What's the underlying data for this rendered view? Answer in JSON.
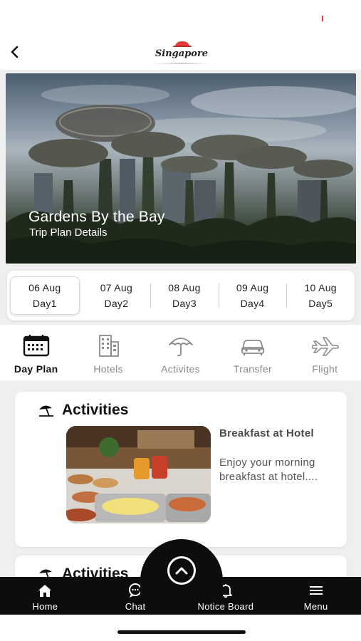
{
  "header": {
    "back_label": "‹",
    "logo_text": "Singapore"
  },
  "hero": {
    "title": "Gardens By the Bay",
    "subtitle": "Trip Plan Details"
  },
  "days": [
    {
      "date": "06 Aug",
      "label": "Day1",
      "active": true
    },
    {
      "date": "07 Aug",
      "label": "Day2",
      "active": false
    },
    {
      "date": "08 Aug",
      "label": "Day3",
      "active": false
    },
    {
      "date": "09 Aug",
      "label": "Day4",
      "active": false
    },
    {
      "date": "10 Aug",
      "label": "Day5",
      "active": false
    }
  ],
  "tabs": [
    {
      "label": "Day Plan",
      "icon": "calendar-icon",
      "active": true
    },
    {
      "label": "Hotels",
      "icon": "building-icon",
      "active": false
    },
    {
      "label": "Activites",
      "icon": "umbrella-icon",
      "active": false
    },
    {
      "label": "Transfer",
      "icon": "car-icon",
      "active": false
    },
    {
      "label": "Flight",
      "icon": "airplane-icon",
      "active": false
    }
  ],
  "cards": [
    {
      "title": "Activities",
      "icon": "beach-umbrella-icon",
      "activity_name": "Breakfast at Hotel",
      "activity_desc": "Enjoy your morning breakfast at hotel...."
    },
    {
      "title": "Activities",
      "icon": "beach-umbrella-icon"
    }
  ],
  "fab": {
    "icon": "chevron-up-icon"
  },
  "bottom_nav": [
    {
      "label": "Home",
      "icon": "home-icon"
    },
    {
      "label": "Chat",
      "icon": "chat-icon"
    },
    {
      "label": "Notice Board",
      "icon": "bell-icon"
    },
    {
      "label": "Menu",
      "icon": "menu-icon"
    }
  ],
  "colors": {
    "accent": "#0d0d0d",
    "logo_hat": "#e03a3a",
    "inactive_tab": "#8a8a8a"
  }
}
